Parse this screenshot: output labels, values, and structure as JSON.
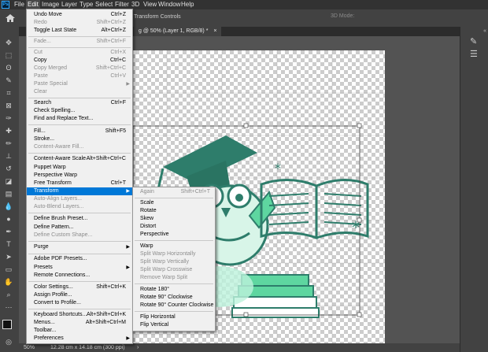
{
  "menubar": {
    "logo": "Ps",
    "items": [
      {
        "label": "File"
      },
      {
        "label": "Edit"
      },
      {
        "label": "Image"
      },
      {
        "label": "Layer"
      },
      {
        "label": "Type"
      },
      {
        "label": "Select"
      },
      {
        "label": "Filter"
      },
      {
        "label": "3D"
      },
      {
        "label": "View"
      },
      {
        "label": "Window"
      },
      {
        "label": "Help"
      }
    ]
  },
  "options_bar": {
    "label": "Transform Controls",
    "mode_3d": "3D Mode:"
  },
  "document_tab": {
    "title": "g @ 50% (Layer 1, RGB/8) *"
  },
  "status_bar": {
    "zoom": "50%",
    "doc_size": "12.28 cm x 14.18 cm (300 ppi)"
  },
  "edit_menu": {
    "items": [
      {
        "label": "Undo Move",
        "shortcut": "Ctrl+Z",
        "disabled": false
      },
      {
        "label": "Redo",
        "shortcut": "Shift+Ctrl+Z",
        "disabled": true
      },
      {
        "label": "Toggle Last State",
        "shortcut": "Alt+Ctrl+Z",
        "disabled": false
      },
      {
        "label": "Fade...",
        "shortcut": "Shift+Ctrl+F",
        "disabled": true
      },
      {
        "label": "Cut",
        "shortcut": "Ctrl+X",
        "disabled": true
      },
      {
        "label": "Copy",
        "shortcut": "Ctrl+C",
        "disabled": false
      },
      {
        "label": "Copy Merged",
        "shortcut": "Shift+Ctrl+C",
        "disabled": true
      },
      {
        "label": "Paste",
        "shortcut": "Ctrl+V",
        "disabled": true
      },
      {
        "label": "Paste Special",
        "shortcut": "",
        "disabled": true
      },
      {
        "label": "Clear",
        "shortcut": "",
        "disabled": true
      },
      {
        "label": "Search",
        "shortcut": "Ctrl+F",
        "disabled": false
      },
      {
        "label": "Check Spelling...",
        "shortcut": "",
        "disabled": false
      },
      {
        "label": "Find and Replace Text...",
        "shortcut": "",
        "disabled": false
      },
      {
        "label": "Fill...",
        "shortcut": "Shift+F5",
        "disabled": false
      },
      {
        "label": "Stroke...",
        "shortcut": "",
        "disabled": false
      },
      {
        "label": "Content-Aware Fill...",
        "shortcut": "",
        "disabled": true
      },
      {
        "label": "Content-Aware Scale",
        "shortcut": "Alt+Shift+Ctrl+C",
        "disabled": false
      },
      {
        "label": "Puppet Warp",
        "shortcut": "",
        "disabled": false
      },
      {
        "label": "Perspective Warp",
        "shortcut": "",
        "disabled": false
      },
      {
        "label": "Free Transform",
        "shortcut": "Ctrl+T",
        "disabled": false
      },
      {
        "label": "Transform",
        "shortcut": "",
        "disabled": false
      },
      {
        "label": "Auto-Align Layers...",
        "shortcut": "",
        "disabled": true
      },
      {
        "label": "Auto-Blend Layers...",
        "shortcut": "",
        "disabled": true
      },
      {
        "label": "Define Brush Preset...",
        "shortcut": "",
        "disabled": false
      },
      {
        "label": "Define Pattern...",
        "shortcut": "",
        "disabled": false
      },
      {
        "label": "Define Custom Shape...",
        "shortcut": "",
        "disabled": true
      },
      {
        "label": "Purge",
        "shortcut": "",
        "disabled": false
      },
      {
        "label": "Adobe PDF Presets...",
        "shortcut": "",
        "disabled": false
      },
      {
        "label": "Presets",
        "shortcut": "",
        "disabled": false
      },
      {
        "label": "Remote Connections...",
        "shortcut": "",
        "disabled": false
      },
      {
        "label": "Color Settings...",
        "shortcut": "Shift+Ctrl+K",
        "disabled": false
      },
      {
        "label": "Assign Profile...",
        "shortcut": "",
        "disabled": false
      },
      {
        "label": "Convert to Profile...",
        "shortcut": "",
        "disabled": false
      },
      {
        "label": "Keyboard Shortcuts...",
        "shortcut": "Alt+Shift+Ctrl+K",
        "disabled": false
      },
      {
        "label": "Menus...",
        "shortcut": "Alt+Shift+Ctrl+M",
        "disabled": false
      },
      {
        "label": "Toolbar...",
        "shortcut": "",
        "disabled": false
      },
      {
        "label": "Preferences",
        "shortcut": "",
        "disabled": false
      }
    ]
  },
  "transform_menu": {
    "items": [
      {
        "label": "Again",
        "shortcut": "Shift+Ctrl+T",
        "disabled": true
      },
      {
        "label": "Scale",
        "shortcut": "",
        "disabled": false
      },
      {
        "label": "Rotate",
        "shortcut": "",
        "disabled": false
      },
      {
        "label": "Skew",
        "shortcut": "",
        "disabled": false
      },
      {
        "label": "Distort",
        "shortcut": "",
        "disabled": false
      },
      {
        "label": "Perspective",
        "shortcut": "",
        "disabled": false
      },
      {
        "label": "Warp",
        "shortcut": "",
        "disabled": false
      },
      {
        "label": "Split Warp Horizontally",
        "shortcut": "",
        "disabled": true
      },
      {
        "label": "Split Warp Vertically",
        "shortcut": "",
        "disabled": true
      },
      {
        "label": "Split Warp Crosswise",
        "shortcut": "",
        "disabled": true
      },
      {
        "label": "Remove Warp Split",
        "shortcut": "",
        "disabled": true
      },
      {
        "label": "Rotate 180°",
        "shortcut": "",
        "disabled": false
      },
      {
        "label": "Rotate 90° Clockwise",
        "shortcut": "",
        "disabled": false
      },
      {
        "label": "Rotate 90° Counter Clockwise",
        "shortcut": "",
        "disabled": false
      },
      {
        "label": "Flip Horizontal",
        "shortcut": "",
        "disabled": false
      },
      {
        "label": "Flip Vertical",
        "shortcut": "",
        "disabled": false
      }
    ]
  },
  "colors": {
    "highlight": "#0078d7",
    "art_green": "#2e7d6b",
    "art_light": "#5ed6a0"
  }
}
